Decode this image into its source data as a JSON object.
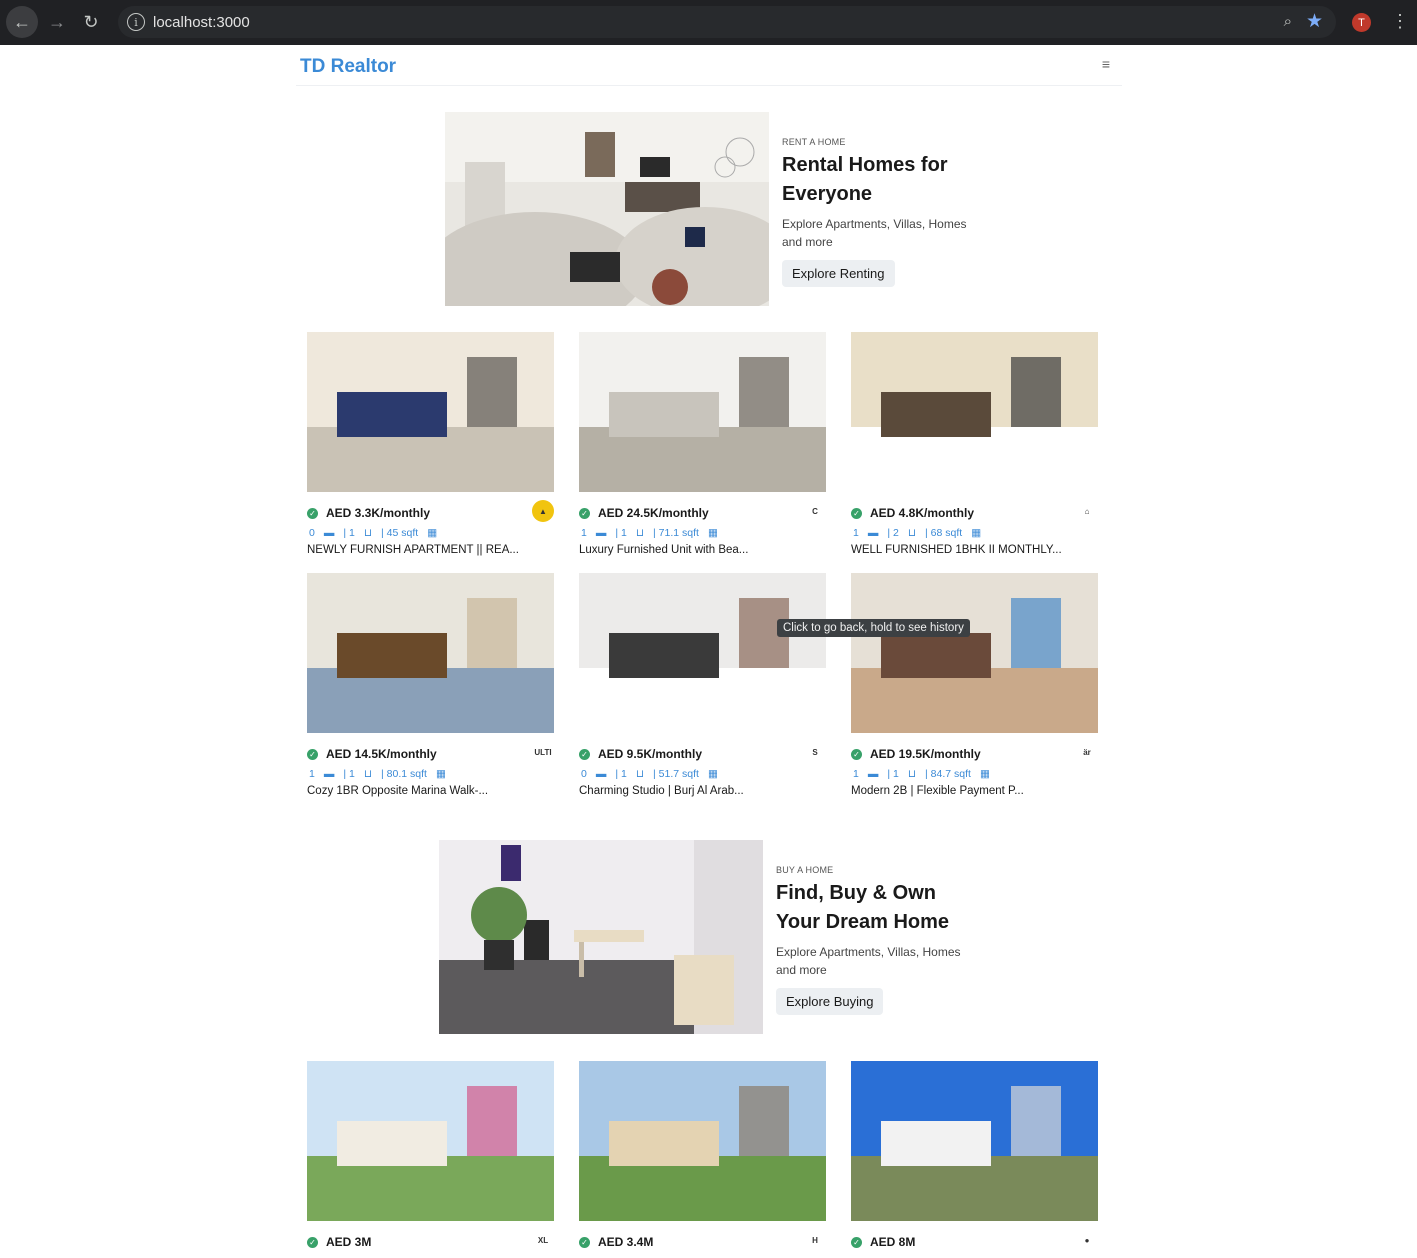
{
  "browser": {
    "url": "localhost:3000",
    "avatar_letter": "T",
    "tooltip": "Click to go back, hold to see history"
  },
  "site": {
    "logo": "TD Realtor",
    "menu_icon": "hamburger-icon"
  },
  "rent_hero": {
    "eyebrow": "RENT A HOME",
    "title": "Rental Homes for Everyone",
    "description": "Explore Apartments, Villas, Homes and more",
    "button": "Explore Renting"
  },
  "buy_hero": {
    "eyebrow": "BUY A HOME",
    "title": "Find, Buy & Own Your Dream Home",
    "description": "Explore Apartments, Villas, Homes and more",
    "button": "Explore Buying"
  },
  "rent_listings": [
    {
      "price": "AED 3.3K/monthly",
      "rooms": "0",
      "baths": "| 1",
      "area": "| 45 sqft",
      "title": "NEWLY FURNISH APARTMENT || REA...",
      "agency_color": "#f1c40f",
      "agency_text": "▲"
    },
    {
      "price": "AED 24.5K/monthly",
      "rooms": "1",
      "baths": "| 1",
      "area": "| 71.1 sqft",
      "title": "Luxury Furnished Unit with Bea...",
      "agency_color": "#ffffff",
      "agency_text": "C"
    },
    {
      "price": "AED 4.8K/monthly",
      "rooms": "1",
      "baths": "| 2",
      "area": "| 68 sqft",
      "title": "WELL FURNISHED 1BHK II MONTHLY...",
      "agency_color": "#ffffff",
      "agency_text": "⌂"
    },
    {
      "price": "AED 14.5K/monthly",
      "rooms": "1",
      "baths": "| 1",
      "area": "| 80.1 sqft",
      "title": "Cozy 1BR Opposite Marina Walk-...",
      "agency_color": "#ffffff",
      "agency_text": "ULTI"
    },
    {
      "price": "AED 9.5K/monthly",
      "rooms": "0",
      "baths": "| 1",
      "area": "| 51.7 sqft",
      "title": "Charming Studio | Burj Al Arab...",
      "agency_color": "#ffffff",
      "agency_text": "S"
    },
    {
      "price": "AED 19.5K/monthly",
      "rooms": "1",
      "baths": "| 1",
      "area": "| 84.7 sqft",
      "title": "Modern 2B | Flexible Payment P...",
      "agency_color": "#ffffff",
      "agency_text": "är"
    }
  ],
  "buy_listings": [
    {
      "price": "AED 3M",
      "agency_text": "XL"
    },
    {
      "price": "AED 3.4M",
      "agency_text": "H"
    },
    {
      "price": "AED 8M",
      "agency_text": "●"
    }
  ]
}
